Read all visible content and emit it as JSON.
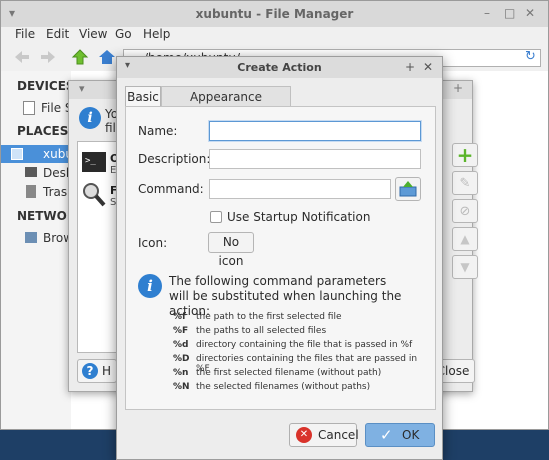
{
  "file_manager": {
    "title": "xubuntu - File Manager",
    "menu": [
      "File",
      "Edit",
      "View",
      "Go",
      "Help"
    ],
    "location": "/home/xubuntu/",
    "sidebar": {
      "devices_header": "DEVICES",
      "devices": [
        "File S"
      ],
      "places_header": "PLACES",
      "places": [
        "xubu",
        "Desk",
        "Trash"
      ],
      "network_header": "NETWORK",
      "network": [
        "Brow"
      ]
    }
  },
  "custom_actions": {
    "intro_line1": "Yo",
    "intro_line2": "fil",
    "rows": [
      {
        "label": "O",
        "sub": "E"
      },
      {
        "label": "F",
        "sub": "S"
      }
    ],
    "help_label": "H",
    "close_label": "Close"
  },
  "create_action": {
    "title": "Create Action",
    "tabs": [
      "Basic",
      "Appearance Conditions"
    ],
    "name_label": "Name:",
    "name_value": "",
    "description_label": "Description:",
    "description_value": "",
    "command_label": "Command:",
    "command_value": "",
    "startup_notification_label": "Use Startup Notification",
    "startup_notification_checked": false,
    "icon_label": "Icon:",
    "icon_button": "No icon",
    "params_intro": "The following command parameters will be substituted when launching the action:",
    "params": [
      {
        "code": "%f",
        "desc": "the path to the first selected file"
      },
      {
        "code": "%F",
        "desc": "the paths to all selected files"
      },
      {
        "code": "%d",
        "desc": "directory containing the file that is passed in %f"
      },
      {
        "code": "%D",
        "desc": "directories containing the files that are passed in %F"
      },
      {
        "code": "%n",
        "desc": "the first selected filename (without path)"
      },
      {
        "code": "%N",
        "desc": "the selected filenames (without paths)"
      }
    ],
    "cancel_label": "Cancel",
    "ok_label": "OK"
  },
  "colors": {
    "desktop": "#1e3f66",
    "selection": "#4a90d9",
    "ok_button": "#7fb1e2",
    "info_icon": "#2f7fd0",
    "add_icon": "#6fbf2f"
  }
}
